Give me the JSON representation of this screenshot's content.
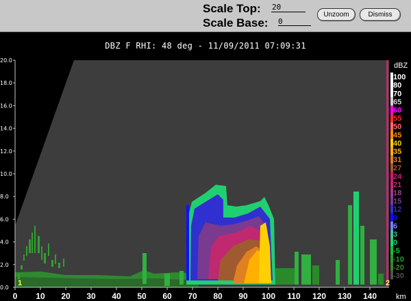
{
  "toolbar": {
    "scale_top_label": "Scale Top:",
    "scale_top_value": "20",
    "scale_base_label": "Scale Base:",
    "scale_base_value": "0",
    "unzoom_label": "Unzoom",
    "dismiss_label": "Dismiss"
  },
  "plot": {
    "title": "DBZ F  RHI: 48 deg  -  11/09/2011 07:09:31",
    "x_unit": "km",
    "x_ticks": [
      "0",
      "10",
      "20",
      "30",
      "40",
      "50",
      "60",
      "70",
      "80",
      "90",
      "100",
      "110",
      "120",
      "130",
      "140"
    ],
    "y_ticks": [
      "0.0",
      "2.0",
      "4.0",
      "6.0",
      "8.0",
      "10.0",
      "12.0",
      "14.0",
      "16.0",
      "18.0",
      "20.0"
    ],
    "marker_left": "1",
    "marker_right": "2"
  },
  "colorbar": {
    "unit": "dBZ",
    "levels": [
      {
        "label": "100",
        "color": "#ffffff"
      },
      {
        "label": "80",
        "color": "#ffffff"
      },
      {
        "label": "70",
        "color": "#ffffff"
      },
      {
        "label": "65",
        "color": "#d0d0d0"
      },
      {
        "label": "60",
        "color": "#ff00ff"
      },
      {
        "label": "55",
        "color": "#ff2a2a"
      },
      {
        "label": "50",
        "color": "#ff6a6a"
      },
      {
        "label": "45",
        "color": "#ff8c00"
      },
      {
        "label": "40",
        "color": "#ffd000"
      },
      {
        "label": "35",
        "color": "#ffb000"
      },
      {
        "label": "31",
        "color": "#e08020"
      },
      {
        "label": "27",
        "color": "#a05a30"
      },
      {
        "label": "24",
        "color": "#d01870"
      },
      {
        "label": "21",
        "color": "#c02870"
      },
      {
        "label": "18",
        "color": "#a03a90"
      },
      {
        "label": "15",
        "color": "#7a3a90"
      },
      {
        "label": "12",
        "color": "#3030d0"
      },
      {
        "label": "9",
        "color": "#1010ff"
      },
      {
        "label": "6",
        "color": "#7a7aff"
      },
      {
        "label": "3",
        "color": "#40c0a0"
      },
      {
        "label": "0",
        "color": "#20d070"
      },
      {
        "label": "-5",
        "color": "#10c040"
      },
      {
        "label": "-10",
        "color": "#20a030"
      },
      {
        "label": "-20",
        "color": "#408030"
      },
      {
        "label": "-30",
        "color": "#505050"
      }
    ]
  }
}
